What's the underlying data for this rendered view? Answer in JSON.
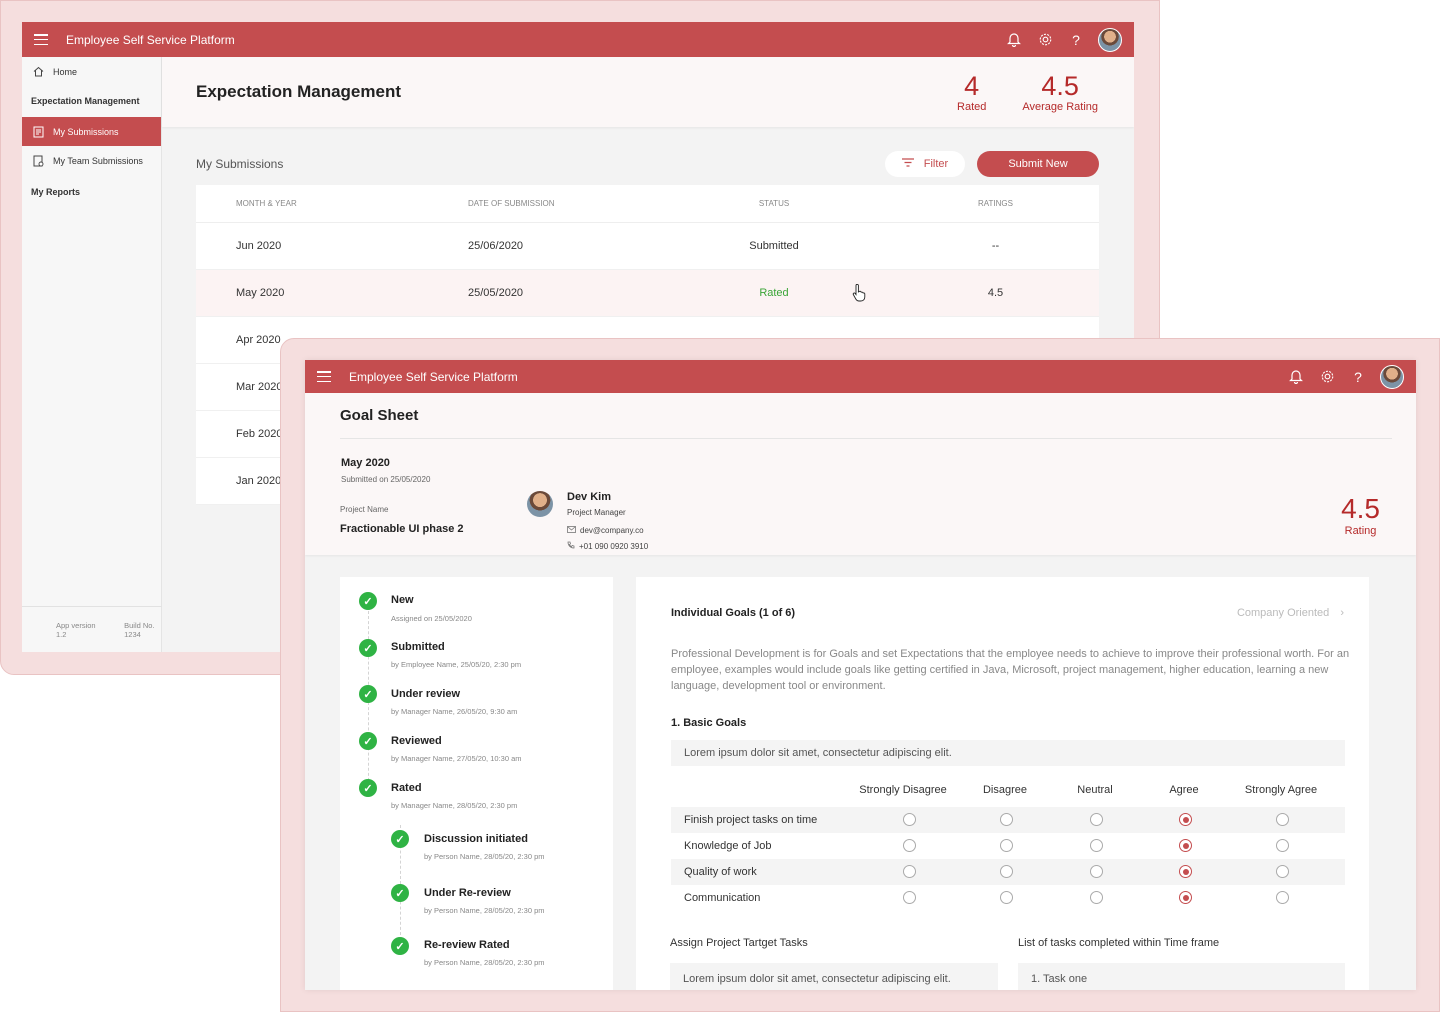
{
  "app": {
    "title": "Employee Self Service Platform"
  },
  "sidebar": {
    "items": [
      {
        "label": "Home"
      },
      {
        "label": "Expectation Management"
      },
      {
        "label": "My Submissions"
      },
      {
        "label": "My Team Submissions"
      },
      {
        "label": "My Reports"
      }
    ],
    "footer": {
      "version": "App version 1.2",
      "build": "Build No. 1234"
    }
  },
  "expectation": {
    "title": "Expectation Management",
    "stats": [
      {
        "value": "4",
        "label": "Rated"
      },
      {
        "value": "4.5",
        "label": "Average Rating"
      }
    ],
    "section_title": "My Submissions",
    "filter_label": "Filter",
    "submit_label": "Submit New",
    "table": {
      "headers": [
        "MONTH & YEAR",
        "DATE OF SUBMISSION",
        "STATUS",
        "RATINGS"
      ],
      "rows": [
        {
          "month": "Jun 2020",
          "date": "25/06/2020",
          "status": "Submitted",
          "rating": "--"
        },
        {
          "month": "May 2020",
          "date": "25/05/2020",
          "status": "Rated",
          "rating": "4.5"
        },
        {
          "month": "Apr 2020",
          "date": "",
          "status": "",
          "rating": ""
        },
        {
          "month": "Mar 2020",
          "date": "",
          "status": "",
          "rating": ""
        },
        {
          "month": "Feb 2020",
          "date": "",
          "status": "",
          "rating": ""
        },
        {
          "month": "Jan 2020",
          "date": "",
          "status": "",
          "rating": ""
        }
      ]
    }
  },
  "goal_sheet": {
    "title": "Goal Sheet",
    "month": "May 2020",
    "submitted": "Submitted on 25/05/2020",
    "project_label": "Project Name",
    "project_name": "Fractionable UI phase 2",
    "person": {
      "name": "Dev Kim",
      "role": "Project Manager",
      "email": "dev@company.co",
      "phone": "+01 090 0920 3910"
    },
    "rating": {
      "value": "4.5",
      "label": "Rating"
    },
    "timeline": [
      {
        "title": "New",
        "sub": "Assigned on 25/05/2020"
      },
      {
        "title": "Submitted",
        "sub": "by Employee Name, 25/05/20, 2:30 pm"
      },
      {
        "title": "Under review",
        "sub": "by Manager Name, 26/05/20, 9:30 am"
      },
      {
        "title": "Reviewed",
        "sub": "by Manager Name, 27/05/20, 10:30 am"
      },
      {
        "title": "Rated",
        "sub": "by Manager Name, 28/05/20, 2:30 pm"
      },
      {
        "title": "Discussion initiated",
        "sub": "by Person Name, 28/05/20, 2:30 pm"
      },
      {
        "title": "Under Re-review",
        "sub": "by Person Name, 28/05/20, 2:30 pm"
      },
      {
        "title": "Re-review Rated",
        "sub": "by Person Name, 28/05/20, 2:30 pm"
      }
    ],
    "goals": {
      "heading": "Individual Goals (1 of 6)",
      "next_label": "Company Oriented",
      "description": "Professional Development is for Goals and set Expectations that the employee needs to achieve to improve their professional worth. For an employee, examples would include goals like getting certified in Java, Microsoft, project management, higher education, learning a new language, development tool or environment.",
      "section": "1. Basic Goals",
      "section_text": "Lorem ipsum dolor sit amet, consectetur adipiscing elit.",
      "scale": [
        "Strongly Disagree",
        "Disagree",
        "Neutral",
        "Agree",
        "Strongly Agree"
      ],
      "criteria": [
        {
          "label": "Finish project tasks on time",
          "selected": 3
        },
        {
          "label": "Knowledge of Job",
          "selected": 3
        },
        {
          "label": "Quality of work",
          "selected": 3
        },
        {
          "label": "Communication",
          "selected": 3
        }
      ],
      "assign_label": "Assign Project Tartget Tasks",
      "assign_text": "Lorem ipsum dolor sit amet, consectetur adipiscing elit.",
      "tasks_label": "List of tasks completed within Time frame",
      "tasks_text": "1. Task one"
    }
  },
  "colors": {
    "brand": "#c44d4f",
    "rating": "#b52a2a",
    "success": "#2fb344",
    "rated_text": "#3aa537"
  }
}
